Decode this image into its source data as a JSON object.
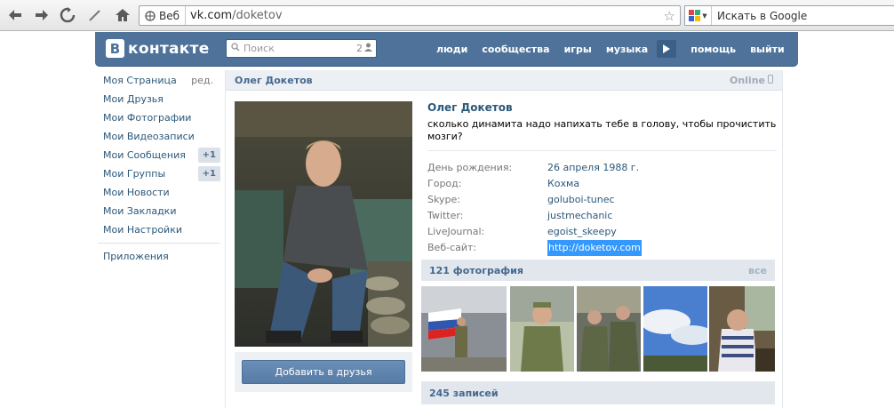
{
  "browser": {
    "address_chip": "Веб",
    "url_host": "vk.com",
    "url_path": "/doketov",
    "search_placeholder": "Искать в Google"
  },
  "vk": {
    "logo_text": "контакте",
    "search_placeholder": "Поиск",
    "search_count": "2",
    "nav": [
      "люди",
      "сообщества",
      "игры",
      "музыка",
      "помощь",
      "выйти"
    ]
  },
  "left_menu": {
    "items": [
      {
        "label": "Моя Страница",
        "extra": "ред."
      },
      {
        "label": "Мои Друзья"
      },
      {
        "label": "Мои Фотографии"
      },
      {
        "label": "Мои Видеозаписи"
      },
      {
        "label": "Мои Сообщения",
        "badge": "+1"
      },
      {
        "label": "Мои Группы",
        "badge": "+1"
      },
      {
        "label": "Мои Новости"
      },
      {
        "label": "Мои Закладки"
      },
      {
        "label": "Мои Настройки"
      }
    ],
    "apps": "Приложения"
  },
  "profile": {
    "header_name": "Олег Докетов",
    "online": "Online",
    "full_name": "Олег Докетов",
    "status": "сколько динамита надо напихать тебе в голову, чтобы прочистить мозги?",
    "fields": [
      {
        "key": "День рождения:",
        "value": "26 апреля 1988 г."
      },
      {
        "key": "Город:",
        "value": "Кохма"
      },
      {
        "key": "Skype:",
        "value": "goluboi-tunec"
      },
      {
        "key": "Twitter:",
        "value": "justmechanic"
      },
      {
        "key": "LiveJournal:",
        "value": "egoist_skeepy"
      },
      {
        "key": "Веб-сайт:",
        "value": "http://doketov.com"
      }
    ],
    "add_friend": "Добавить в друзья",
    "photos_title": "121 фотография",
    "photos_all": "все",
    "posts_title": "245 записей"
  },
  "colors": {
    "vk_blue": "#4e729a",
    "link": "#2b587a",
    "selection": "#3399ff"
  }
}
